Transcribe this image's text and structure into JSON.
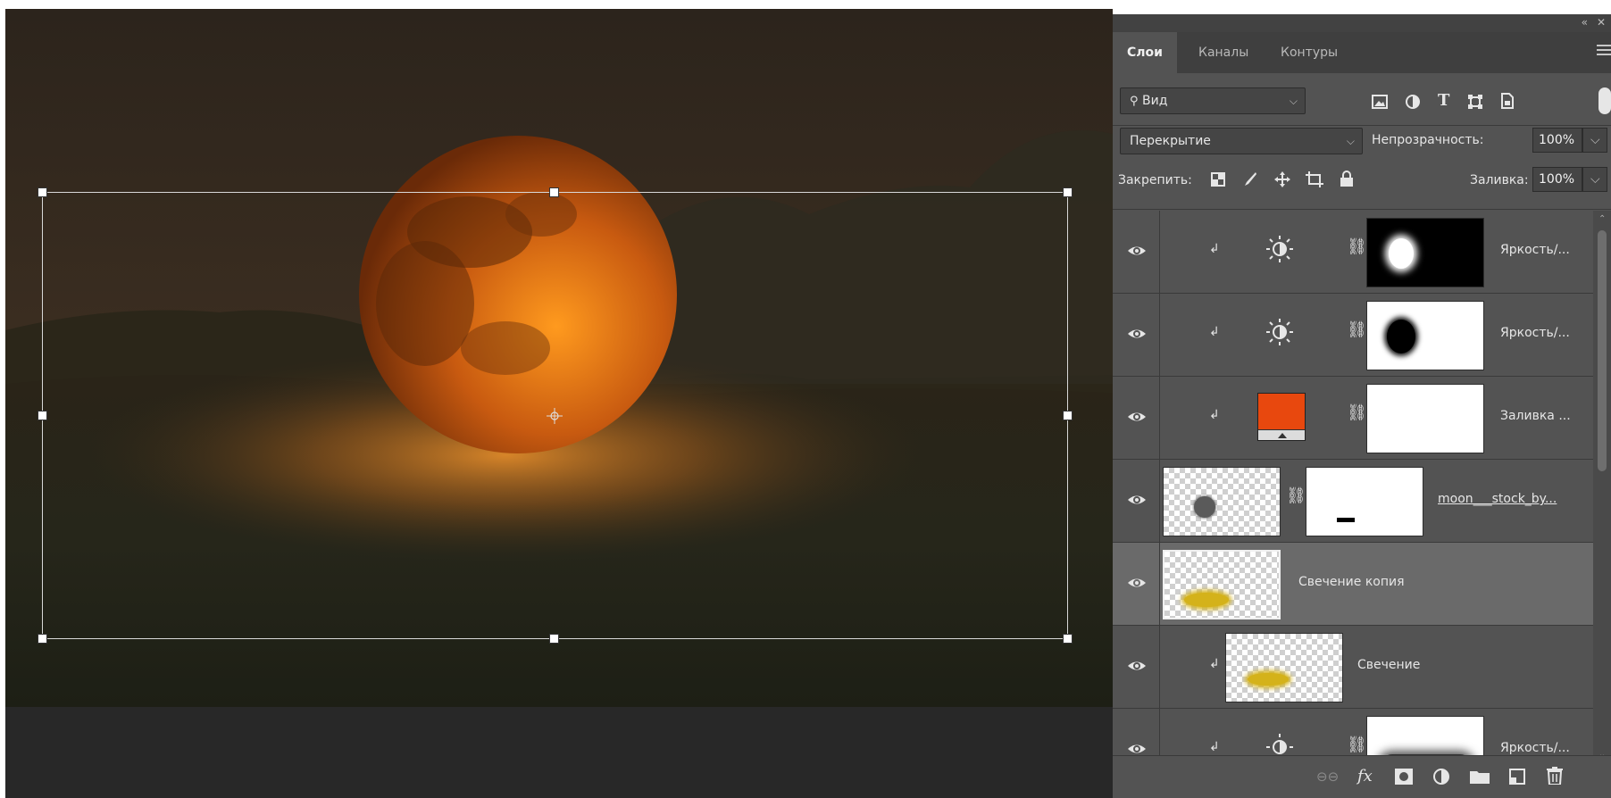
{
  "panel": {
    "tabs": [
      {
        "label": "Слои",
        "active": true
      },
      {
        "label": "Каналы",
        "active": false
      },
      {
        "label": "Контуры",
        "active": false
      }
    ],
    "filter": {
      "label": "Вид"
    },
    "blend_mode": "Перекрытие",
    "opacity_label": "Непрозрачность:",
    "opacity_value": "100%",
    "lock_label": "Закрепить:",
    "fill_label": "Заливка:",
    "fill_value": "100%",
    "filter_icons": [
      "image-filter-icon",
      "adjustment-filter-icon",
      "type-filter-icon",
      "shape-filter-icon",
      "smart-object-filter-icon"
    ],
    "lock_icons": [
      "lock-transparent-pixels-icon",
      "lock-image-pixels-icon",
      "lock-position-icon",
      "lock-artboard-icon",
      "lock-all-icon"
    ],
    "layers": [
      {
        "name": "Яркость/...",
        "kind": "adjustment",
        "clipped": true,
        "visible": true,
        "mask": "black-white-spot"
      },
      {
        "name": "Яркость/...",
        "kind": "adjustment",
        "clipped": true,
        "visible": true,
        "mask": "white-black-spot"
      },
      {
        "name": "Заливка ...",
        "kind": "fill",
        "clipped": true,
        "visible": true,
        "fill_color": "#e8480e",
        "mask": "white"
      },
      {
        "name": "moon___stock_by...",
        "kind": "smart-object",
        "clipped": false,
        "visible": true,
        "mask": "white-small-mark"
      },
      {
        "name": "Свечение копия",
        "kind": "pixel",
        "clipped": false,
        "visible": true,
        "selected": true
      },
      {
        "name": "Свечение",
        "kind": "pixel",
        "clipped": true,
        "visible": true
      },
      {
        "name": "Яркость/...",
        "kind": "adjustment",
        "clipped": true,
        "visible": true,
        "mask": "white-dark-edge"
      }
    ],
    "bottom_icons": [
      "link-layers-icon",
      "fx-icon",
      "add-mask-icon",
      "new-adjustment-icon",
      "new-group-icon",
      "new-layer-icon",
      "delete-layer-icon"
    ],
    "fx_label": "fx"
  },
  "colors": {
    "panel_bg": "#535353",
    "selected_row": "#6a6a6a",
    "fill_swatch": "#e8480e",
    "glow": "#d4b21a"
  }
}
